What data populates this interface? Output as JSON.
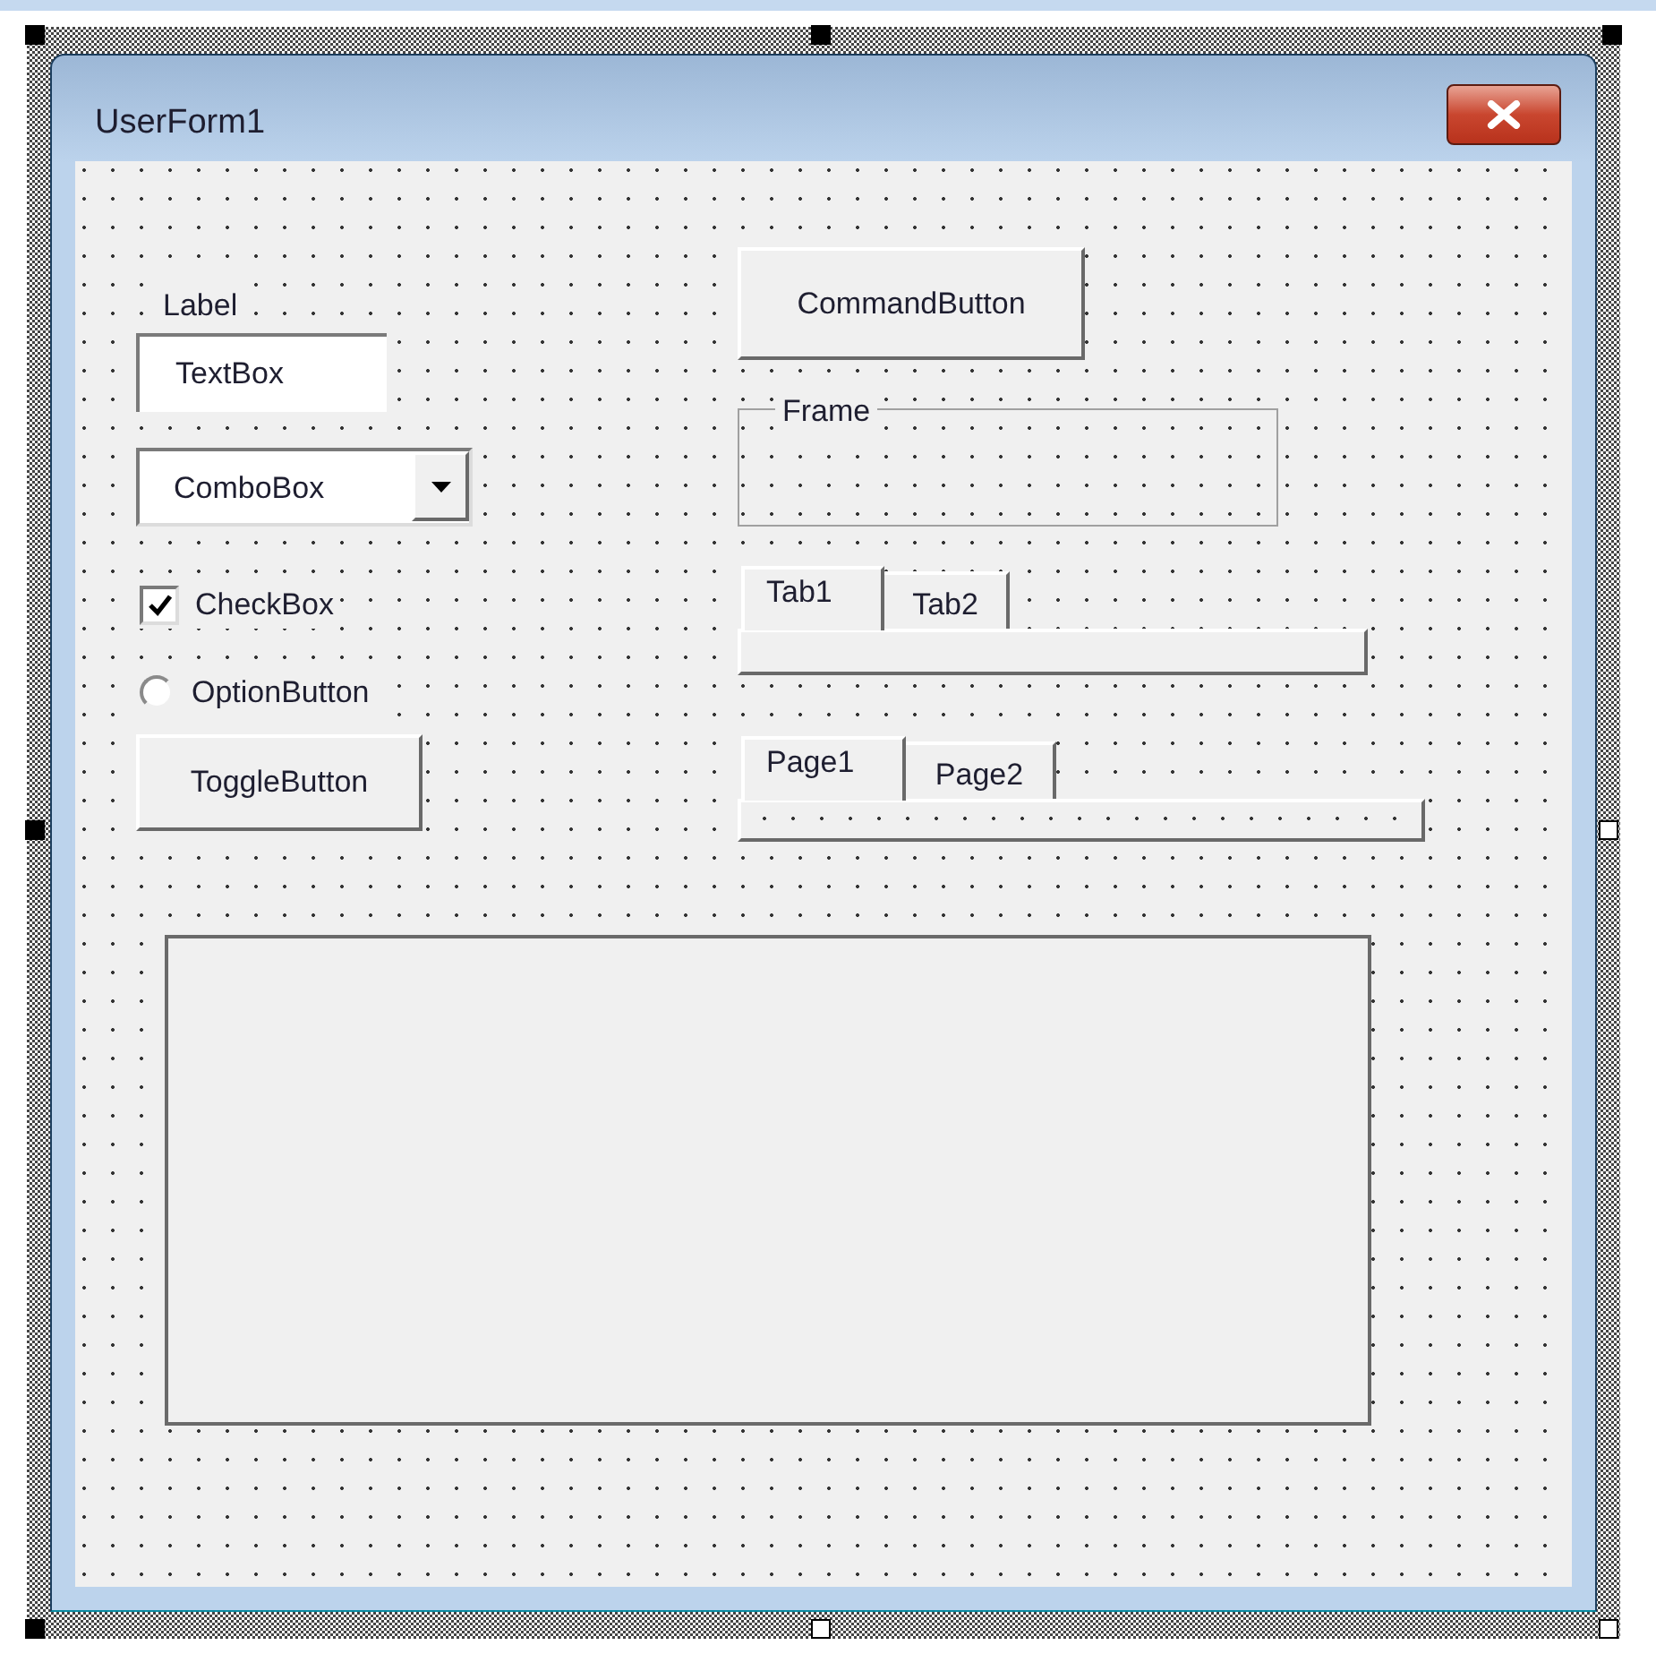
{
  "window": {
    "title": "UserForm1"
  },
  "controls": [
    {
      "kind": "label",
      "text": "Label"
    },
    {
      "kind": "textbox",
      "value": "TextBox"
    },
    {
      "kind": "combobox",
      "value": "ComboBox"
    },
    {
      "kind": "checkbox",
      "label": "CheckBox",
      "checked": true
    },
    {
      "kind": "option",
      "label": "OptionButton",
      "selected": false
    },
    {
      "kind": "toggle",
      "label": "ToggleButton"
    },
    {
      "kind": "command",
      "label": "CommandButton"
    },
    {
      "kind": "frame",
      "caption": "Frame"
    },
    {
      "kind": "tabstrip",
      "tabs": [
        {
          "label": "Tab1",
          "selected": true
        },
        {
          "label": "Tab2",
          "selected": false
        }
      ]
    },
    {
      "kind": "multipage",
      "tabs": [
        {
          "label": "Page1",
          "selected": true
        },
        {
          "label": "Page2",
          "selected": false
        }
      ]
    },
    {
      "kind": "image"
    }
  ]
}
